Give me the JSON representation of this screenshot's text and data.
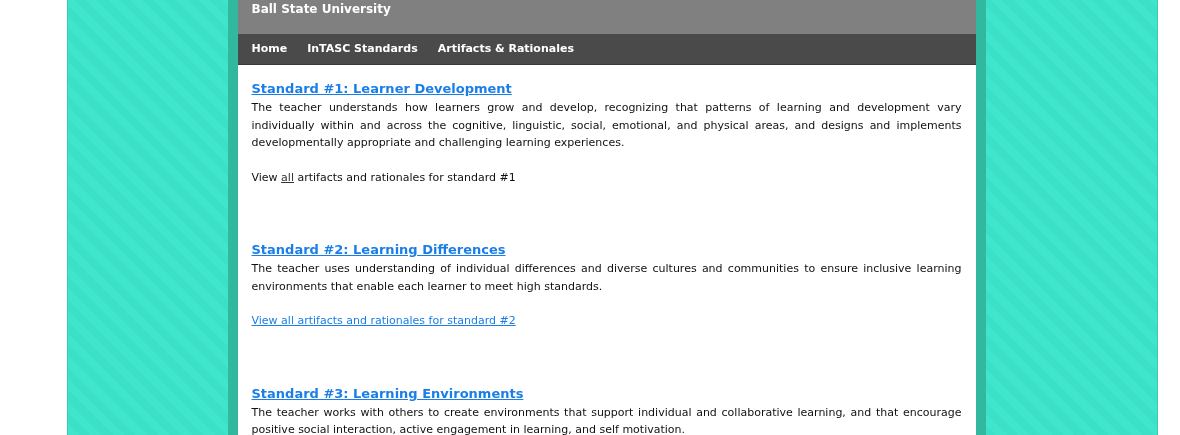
{
  "header": {
    "title": "Ball State University"
  },
  "nav": [
    {
      "label": "Home"
    },
    {
      "label": "InTASC Standards"
    },
    {
      "label": "Artifacts & Rationales"
    }
  ],
  "standards": [
    {
      "title": "Standard #1: Learner Development",
      "text": "The teacher understands how learners grow and develop, recognizing that patterns of learning and development vary individually within and across the cognitive, linguistic, social, emotional, and physical areas, and designs and implements developmentally appropriate and challenging learning experiences.",
      "view": {
        "kind": "inline",
        "before": "View ",
        "link": "all",
        "after": " artifacts and rationales for standard #1"
      }
    },
    {
      "title": "Standard #2: Learning Differences",
      "text": "The teacher uses understanding of individual differences and diverse cultures and communities to ensure inclusive learning environments that enable each learner to meet high standards.",
      "view": {
        "kind": "link",
        "link": "View all artifacts and rationales for standard #2"
      }
    },
    {
      "title": "Standard #3: Learning Environments",
      "text": "The teacher works with others to create environments that support individual and collaborative learning, and that encourage positive social interaction, active engagement in learning, and self motivation."
    }
  ]
}
